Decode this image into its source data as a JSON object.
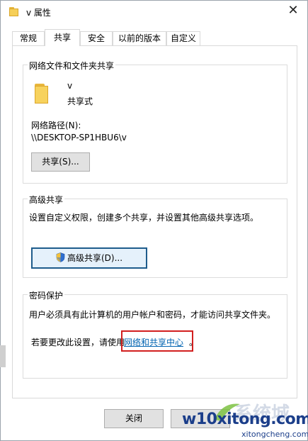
{
  "window": {
    "title": "v 属性",
    "close_glyph": "✕"
  },
  "tabs": [
    {
      "label": "常规"
    },
    {
      "label": "共享"
    },
    {
      "label": "安全"
    },
    {
      "label": "以前的版本"
    },
    {
      "label": "自定义"
    }
  ],
  "network_share": {
    "group_title": "网络文件和文件夹共享",
    "folder_name": "v",
    "share_status": "共享式",
    "path_label": "网络路径(N):",
    "path_value": "\\\\DESKTOP-SP1HBU6\\v",
    "share_button": "共享(S)..."
  },
  "advanced_share": {
    "group_title": "高级共享",
    "description": "设置自定义权限，创建多个共享，并设置其他高级共享选项。",
    "button": "高级共享(D)..."
  },
  "password": {
    "group_title": "密码保护",
    "description": "用户必须具有此计算机的用户帐户和密码，才能访问共享文件夹。",
    "change_prefix": "若要更改此设置，请使用",
    "link_text": "网络和共享中心",
    "change_suffix": "。"
  },
  "footer": {
    "close_button": "关闭"
  },
  "watermark": {
    "main": "w10xitong.com",
    "sub": "xitongcheng.com",
    "ghost": "系统城"
  },
  "colors": {
    "accent_link": "#0063b1",
    "highlight_box": "#d21f1f",
    "folder_yellow": "#f7d25d",
    "focus_border": "#1e5c8c"
  },
  "icons": {
    "title_icon": "folder-icon",
    "folder_big": "folder-icon",
    "shield": "uac-shield-icon"
  }
}
